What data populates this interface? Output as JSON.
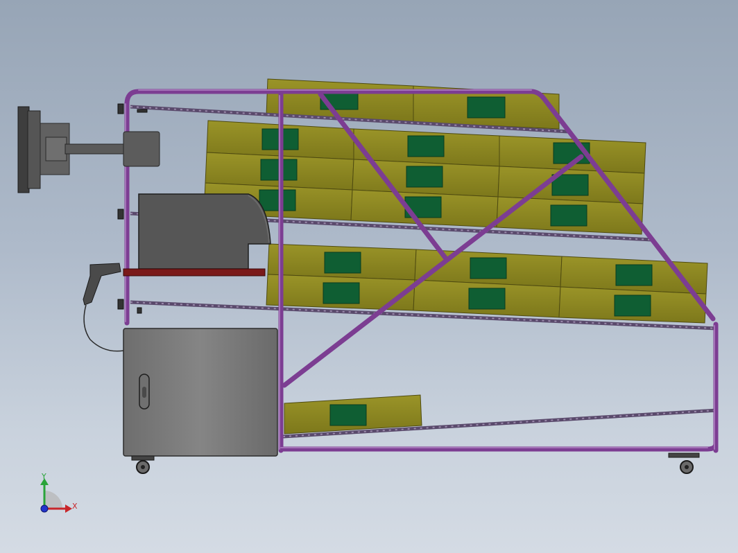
{
  "viewport": {
    "background_top": "#97a5b6",
    "background_bottom": "#d4dbe4"
  },
  "colors": {
    "frame": "#8b4aa0",
    "frame_highlight": "#b07ac2",
    "bin": "#8b8621",
    "bin_dark": "#6f6a16",
    "bin_label": "#0f5e33",
    "roller_track": "#6c5580",
    "cabinet": "#787878",
    "printer": "#5a5a5a",
    "shelf": "#7a1a1a",
    "monitor": "#4e4e4e"
  },
  "triad": {
    "x_label": "X",
    "y_label": "Y",
    "x_color": "#c8262a",
    "y_color": "#2aa43a",
    "z_color": "#2233cc"
  },
  "icons": {
    "monitor": "monitor-icon",
    "printer": "printer-icon",
    "scanner": "barcode-scanner-icon",
    "cabinet": "cabinet-icon",
    "caster": "caster-wheel-icon",
    "triad": "axis-triad-icon"
  }
}
